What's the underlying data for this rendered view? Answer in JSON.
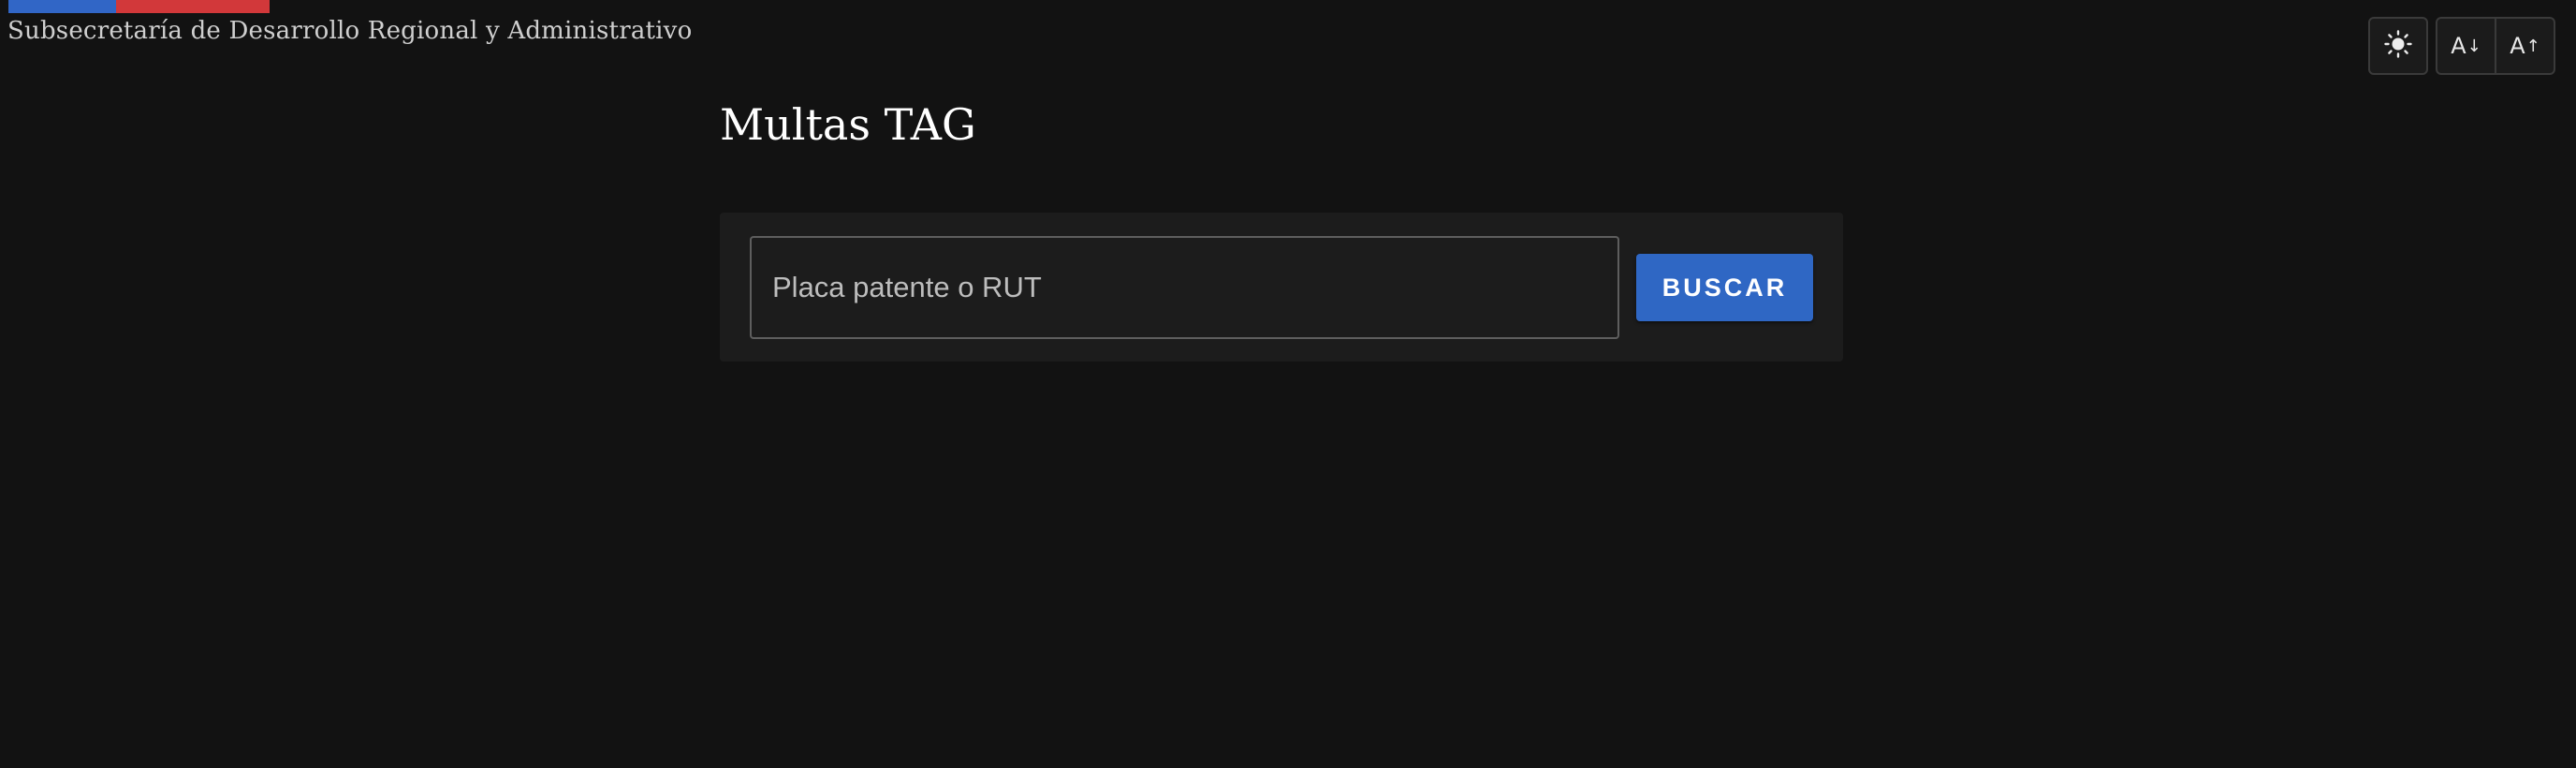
{
  "header": {
    "org_name": "Subsecretaría de Desarrollo Regional y Administrativo",
    "flag_colors": {
      "blue": "#3166c6",
      "red": "#d2383a"
    }
  },
  "toolbar": {
    "theme_toggle_icon": "sun-icon",
    "font_decrease_label": "A",
    "font_decrease_icon": "font-size-decrease-icon",
    "font_increase_label": "A",
    "font_increase_icon": "font-size-increase-icon"
  },
  "main": {
    "title": "Multas TAG",
    "search": {
      "placeholder": "Placa patente o RUT",
      "value": "",
      "button_label": "BUSCAR"
    }
  },
  "colors": {
    "background": "#121212",
    "panel": "#1c1c1c",
    "accent": "#2f67c4"
  }
}
